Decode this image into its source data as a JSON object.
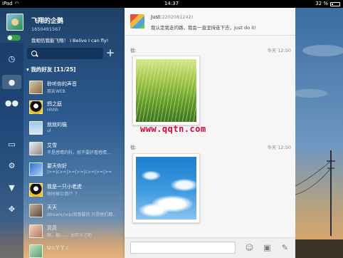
{
  "status_bar": {
    "carrier": "iPad",
    "time": "14:37",
    "battery": "32 %",
    "battery_fraction": 0.32
  },
  "profile": {
    "nickname": "飞翔的企鹅",
    "qq_number": "1650491567",
    "signature": "我相信我能飞翔！ I Belive I can fly!"
  },
  "search": {
    "placeholder": ""
  },
  "group": {
    "title": "我的好友 [11/25]"
  },
  "friends": [
    {
      "name": "聆听你的声音",
      "status": "朋友WEB"
    },
    {
      "name": "鸽之庭",
      "status": "Hhhh"
    },
    {
      "name": "就就的猫",
      "status": "ul"
    },
    {
      "name": "艾雪",
      "status": "不是感情的料，就不要好看感情..."
    },
    {
      "name": "要天你好",
      "status": "|>=|c>=|>=|>=|c>=|>=|>="
    },
    {
      "name": "我是一只小老虎",
      "status": "啥时候公测?？？"
    },
    {
      "name": "天天",
      "status": "/dream//vip/我想要的 只是他们都..."
    },
    {
      "name": "贝贝",
      "status": "啊、额、、、、太吓人了吧"
    },
    {
      "name": "U☆丫丫☆",
      "status": ""
    }
  ],
  "chat": {
    "peer_name": "Just",
    "peer_id": "(2202081242)",
    "peer_signature": "我认定我走的路，我会一直坚持走下去，Just do it!",
    "messages": [
      {
        "sender": "我:",
        "time": "今天 12:50",
        "image": "wheat-field-photo"
      },
      {
        "sender": "我:",
        "time": "今天 12:50",
        "image": "blue-sky-clouds-photo"
      }
    ]
  },
  "watermark": "www.qqtn.com",
  "icons": {
    "rail": [
      "clock-icon",
      "contacts-icon",
      "group-icon",
      "card-icon",
      "gear-icon",
      "shirt-icon",
      "apps-icon"
    ],
    "input": [
      "emoji-icon",
      "image-icon",
      "brush-icon"
    ]
  }
}
